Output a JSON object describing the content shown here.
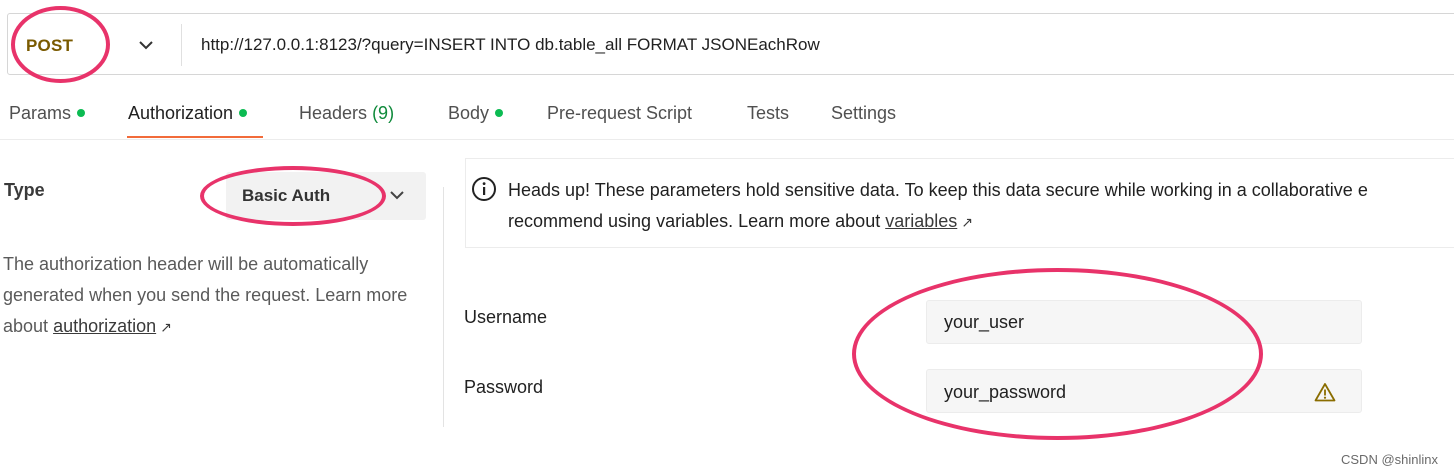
{
  "request": {
    "method": "POST",
    "url": "http://127.0.0.1:8123/?query=INSERT INTO db.table_all FORMAT JSONEachRow"
  },
  "tabs": [
    {
      "label": "Params",
      "dot": true
    },
    {
      "label": "Authorization",
      "dot": true,
      "active": true
    },
    {
      "label": "Headers",
      "count": "(9)"
    },
    {
      "label": "Body",
      "dot": true
    },
    {
      "label": "Pre-request Script"
    },
    {
      "label": "Tests"
    },
    {
      "label": "Settings"
    }
  ],
  "auth": {
    "type_label": "Type",
    "type_value": "Basic Auth",
    "help_text": "The authorization header will be automatically generated when you send the request. Learn more about",
    "help_link": "authorization"
  },
  "note": {
    "line1": "Heads up! These parameters hold sensitive data. To keep this data secure while working in a collaborative e",
    "line2": "recommend using variables. Learn more about",
    "link": "variables"
  },
  "fields": {
    "username_label": "Username",
    "username_value": "your_user",
    "password_label": "Password",
    "password_value": "your_password"
  },
  "colors": {
    "annotation": "#e8336a",
    "active_tab_underline": "#f26b3a",
    "status_dot": "#0cbb52",
    "method": "#7a5a00"
  },
  "watermark": "CSDN @shinlinx"
}
